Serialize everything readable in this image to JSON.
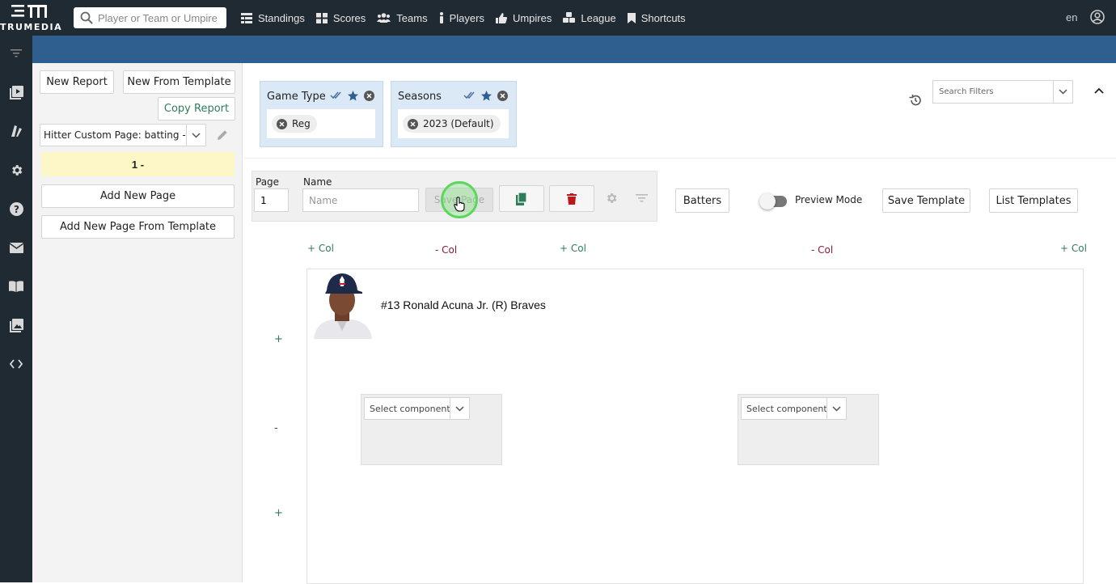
{
  "brand": {
    "name": "TRUMEDIA"
  },
  "search": {
    "placeholder": "Player or Team or Umpire"
  },
  "nav": {
    "items": [
      {
        "label": "Standings",
        "icon": "table-icon"
      },
      {
        "label": "Scores",
        "icon": "grid-icon"
      },
      {
        "label": "Teams",
        "icon": "users-icon"
      },
      {
        "label": "Players",
        "icon": "person-icon"
      },
      {
        "label": "Umpires",
        "icon": "thumb-icon"
      },
      {
        "label": "League",
        "icon": "cubes-icon"
      },
      {
        "label": "Shortcuts",
        "icon": "bookmark-icon"
      }
    ]
  },
  "header": {
    "lang": "en"
  },
  "left": {
    "new_report": "New Report",
    "new_from_template": "New From Template",
    "copy_report": "Copy Report",
    "report_select": "Hitter Custom Page: batting - P...",
    "page_item": "1 -",
    "add_new_page": "Add New Page",
    "add_from_template": "Add New Page From Template"
  },
  "filters": {
    "cards": [
      {
        "title": "Game Type",
        "chip": "Reg"
      },
      {
        "title": "Seasons",
        "chip": "2023 (Default)"
      }
    ],
    "search_placeholder": "Search Filters"
  },
  "toolbar": {
    "page_label": "Page",
    "page_value": "1",
    "name_label": "Name",
    "name_placeholder": "Name",
    "save_page": "Save Page",
    "batters": "Batters",
    "preview_mode": "Preview Mode",
    "save_template": "Save Template",
    "list_templates": "List Templates"
  },
  "layout": {
    "col_controls": [
      "+ Col",
      "- Col",
      "+ Col",
      "- Col",
      "+ Col"
    ],
    "row_controls": [
      "+",
      "-",
      "+"
    ]
  },
  "player": {
    "title": "#13 Ronald Acuna Jr. (R) Braves"
  },
  "components": [
    {
      "placeholder": "Select component"
    },
    {
      "placeholder": "Select component"
    }
  ],
  "colors": {
    "topbar": "#1f2a33",
    "bluebar": "#2e5f8f",
    "accent_green": "#2e7d5b",
    "filter_card": "#dbe9f6",
    "page_highlight": "#fdf6c6"
  }
}
